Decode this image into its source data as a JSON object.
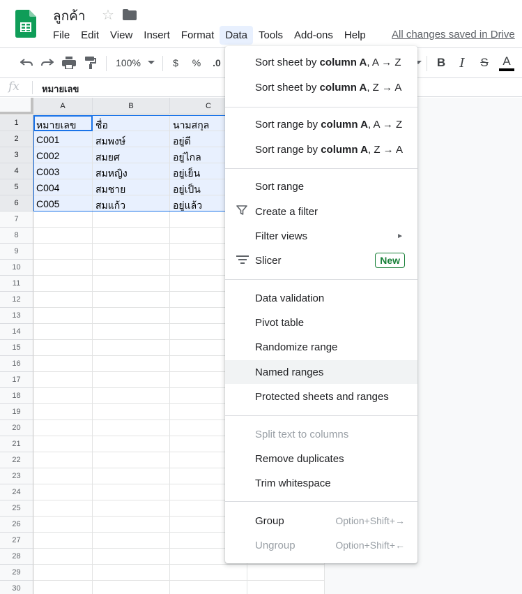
{
  "header": {
    "title": "ลูกค้า",
    "save_status": "All changes saved in Drive",
    "menus": [
      "File",
      "Edit",
      "View",
      "Insert",
      "Format",
      "Data",
      "Tools",
      "Add-ons",
      "Help"
    ]
  },
  "toolbar": {
    "zoom": "100%",
    "currency": "$",
    "percent": "%",
    "decimal": ".0",
    "text_color_glyph": "A"
  },
  "formula_bar": {
    "fx": "fx",
    "value": "หมายเลข"
  },
  "grid": {
    "columns": [
      "A",
      "B",
      "C"
    ],
    "rows": [
      "1",
      "2",
      "3",
      "4",
      "5",
      "6",
      "7",
      "8",
      "9",
      "10",
      "11",
      "12",
      "13",
      "14",
      "15",
      "16",
      "17",
      "18",
      "19",
      "20",
      "21",
      "22",
      "23",
      "24",
      "25",
      "26",
      "27",
      "28",
      "29",
      "30"
    ],
    "cells": [
      [
        "หมายเลข",
        "ชื่อ",
        "นามสกุล"
      ],
      [
        "C001",
        "สมพงษ์",
        "อยู่ดี"
      ],
      [
        "C002",
        "สมยศ",
        "อยู่ไกล"
      ],
      [
        "C003",
        "สมหญิง",
        "อยู่เย็น"
      ],
      [
        "C004",
        "สมชาย",
        "อยู่เป็น"
      ],
      [
        "C005",
        "สมแก้ว",
        "อยู่แล้ว"
      ]
    ]
  },
  "data_menu": {
    "sort_sheet_az": {
      "pre": "Sort sheet by ",
      "bold": "column A",
      "post": ", A → Z"
    },
    "sort_sheet_za": {
      "pre": "Sort sheet by ",
      "bold": "column A",
      "post": ", Z → A"
    },
    "sort_range_az": {
      "pre": "Sort range by ",
      "bold": "column A",
      "post": ", A → Z"
    },
    "sort_range_za": {
      "pre": "Sort range by ",
      "bold": "column A",
      "post": ", Z → A"
    },
    "sort_range": "Sort range",
    "create_filter": "Create a filter",
    "filter_views": "Filter views",
    "slicer": "Slicer",
    "slicer_badge": "New",
    "data_validation": "Data validation",
    "pivot_table": "Pivot table",
    "randomize_range": "Randomize range",
    "named_ranges": "Named ranges",
    "protected": "Protected sheets and ranges",
    "split_text": "Split text to columns",
    "remove_duplicates": "Remove duplicates",
    "trim_whitespace": "Trim whitespace",
    "group": "Group",
    "group_shortcut": "Option+Shift+→",
    "ungroup": "Ungroup",
    "ungroup_shortcut": "Option+Shift+←"
  },
  "colors": {
    "accent": "#1a73e8",
    "sheets_green": "#0f9d58",
    "badge_green": "#188038"
  }
}
